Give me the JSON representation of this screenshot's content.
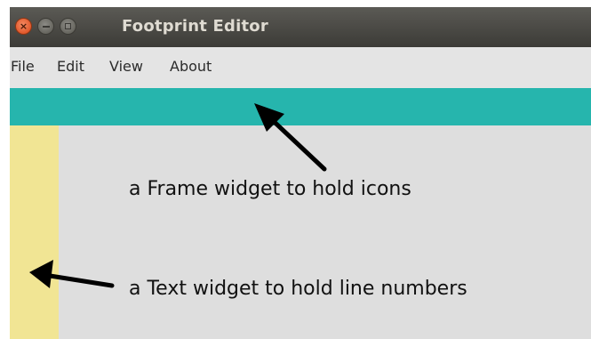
{
  "window": {
    "title": "Footprint Editor",
    "controls": {
      "close_glyph": "×"
    }
  },
  "menubar": {
    "items": [
      "File",
      "Edit",
      "View",
      "About"
    ]
  },
  "annotations": {
    "frame": "a Frame widget to hold icons",
    "text": "a Text widget to hold line numbers"
  },
  "colors": {
    "frame_widget": "#26b5ad",
    "text_widget": "#f1e594",
    "window_background": "#dedede",
    "close_button": "#e0582b"
  }
}
